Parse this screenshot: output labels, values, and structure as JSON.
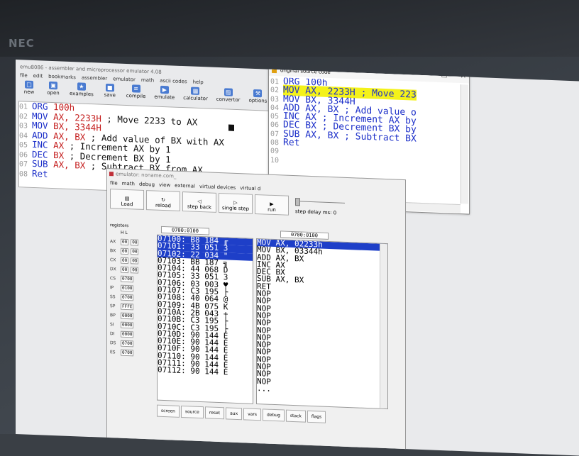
{
  "brand": "NEC",
  "main_window": {
    "title": "emu8086 - assembler and microprocessor emulator 4.08",
    "menu": [
      "file",
      "edit",
      "bookmarks",
      "assembler",
      "emulator",
      "math",
      "ascii codes",
      "help"
    ],
    "toolbar": [
      "new",
      "open",
      "examples",
      "save",
      "compile",
      "emulate",
      "calculator",
      "convertor",
      "options"
    ],
    "code_lines": [
      {
        "n": "01",
        "kw": "ORG",
        "ops": "100h",
        "comment": ""
      },
      {
        "n": "02",
        "kw": "MOV",
        "ops": "AX, 2233H",
        "comment": "; Move 2233 to AX"
      },
      {
        "n": "03",
        "kw": "MOV",
        "ops": "BX, 3344H",
        "comment": ""
      },
      {
        "n": "04",
        "kw": "ADD",
        "ops": "AX, BX",
        "comment": "; Add value of BX with AX"
      },
      {
        "n": "05",
        "kw": "INC",
        "ops": "AX",
        "comment": "; Increment AX by 1"
      },
      {
        "n": "06",
        "kw": "DEC",
        "ops": "BX",
        "comment": "; Decrement BX by 1"
      },
      {
        "n": "07",
        "kw": "SUB",
        "ops": "AX, BX",
        "comment": "; Subtract BX from AX"
      },
      {
        "n": "08",
        "kw": "Ret",
        "ops": "",
        "comment": ""
      }
    ]
  },
  "source_window": {
    "title": "original source code",
    "buttons": [
      "—",
      "☐",
      "✕"
    ],
    "lines": [
      {
        "n": "01",
        "text": "ORG 100h"
      },
      {
        "n": "02",
        "text": "MOV AX, 2233H ; Move 223",
        "highlight": true
      },
      {
        "n": "03",
        "text": "MOV BX, 3344H"
      },
      {
        "n": "04",
        "text": "ADD AX, BX ; Add value o"
      },
      {
        "n": "05",
        "text": "INC AX ; Increment AX by"
      },
      {
        "n": "06",
        "text": "DEC BX ; Decrement BX by"
      },
      {
        "n": "07",
        "text": "SUB AX, BX ; Subtract BX"
      },
      {
        "n": "08",
        "text": "Ret"
      },
      {
        "n": "09",
        "text": ""
      },
      {
        "n": "10",
        "text": ""
      }
    ]
  },
  "emulator": {
    "title": "emulator: noname.com_",
    "menu": [
      "file",
      "math",
      "debug",
      "view",
      "external",
      "virtual devices",
      "virtual d"
    ],
    "tools": [
      "Load",
      "reload",
      "step back",
      "single step",
      "run"
    ],
    "step_delay": "step delay ms: 0",
    "registers_label": "registers",
    "hl_header": [
      "H",
      "L"
    ],
    "registers": [
      {
        "name": "AX",
        "h": "00",
        "l": "00"
      },
      {
        "name": "BX",
        "h": "00",
        "l": "00"
      },
      {
        "name": "CX",
        "h": "00",
        "l": "0D"
      },
      {
        "name": "DX",
        "h": "00",
        "l": "00"
      },
      {
        "name": "CS",
        "v": "0700"
      },
      {
        "name": "IP",
        "v": "0100"
      },
      {
        "name": "SS",
        "v": "0700"
      },
      {
        "name": "SP",
        "v": "FFFE"
      },
      {
        "name": "BP",
        "v": "0000"
      },
      {
        "name": "SI",
        "v": "0000"
      },
      {
        "name": "DI",
        "v": "0000"
      },
      {
        "name": "DS",
        "v": "0700"
      },
      {
        "name": "ES",
        "v": "0700"
      }
    ],
    "mem_addr": "0700:0100",
    "dis_addr": "0700:0100",
    "memory": [
      {
        "a": "07100:",
        "h": "B8",
        "d": "184",
        "c": "╓",
        "sel": true
      },
      {
        "a": "07101:",
        "h": "33",
        "d": "051",
        "c": "3",
        "sel": true
      },
      {
        "a": "07102:",
        "h": "22",
        "d": "034",
        "c": "\"",
        "sel": true
      },
      {
        "a": "07103:",
        "h": "BB",
        "d": "187",
        "c": "╗"
      },
      {
        "a": "07104:",
        "h": "44",
        "d": "068",
        "c": "D"
      },
      {
        "a": "07105:",
        "h": "33",
        "d": "051",
        "c": "3"
      },
      {
        "a": "07106:",
        "h": "03",
        "d": "003",
        "c": "♥"
      },
      {
        "a": "07107:",
        "h": "C3",
        "d": "195",
        "c": "├"
      },
      {
        "a": "07108:",
        "h": "40",
        "d": "064",
        "c": "@"
      },
      {
        "a": "07109:",
        "h": "4B",
        "d": "075",
        "c": "K"
      },
      {
        "a": "0710A:",
        "h": "2B",
        "d": "043",
        "c": "+"
      },
      {
        "a": "0710B:",
        "h": "C3",
        "d": "195",
        "c": "├"
      },
      {
        "a": "0710C:",
        "h": "C3",
        "d": "195",
        "c": "├"
      },
      {
        "a": "0710D:",
        "h": "90",
        "d": "144",
        "c": "É"
      },
      {
        "a": "0710E:",
        "h": "90",
        "d": "144",
        "c": "É"
      },
      {
        "a": "0710F:",
        "h": "90",
        "d": "144",
        "c": "É"
      },
      {
        "a": "07110:",
        "h": "90",
        "d": "144",
        "c": "É"
      },
      {
        "a": "07111:",
        "h": "90",
        "d": "144",
        "c": "É"
      },
      {
        "a": "07112:",
        "h": "90",
        "d": "144",
        "c": "É"
      }
    ],
    "disassembly": [
      {
        "t": "MOV AX, 02233h",
        "sel": true
      },
      {
        "t": "MOV BX, 03344h"
      },
      {
        "t": "ADD AX, BX"
      },
      {
        "t": "INC AX"
      },
      {
        "t": "DEC BX"
      },
      {
        "t": "SUB AX, BX"
      },
      {
        "t": "RET"
      },
      {
        "t": "NOP"
      },
      {
        "t": "NOP"
      },
      {
        "t": "NOP"
      },
      {
        "t": "NOP"
      },
      {
        "t": "NOP"
      },
      {
        "t": "NOP"
      },
      {
        "t": "NOP"
      },
      {
        "t": "NOP"
      },
      {
        "t": "NOP"
      },
      {
        "t": "NOP"
      },
      {
        "t": "NOP"
      },
      {
        "t": "NOP"
      },
      {
        "t": "NOP"
      },
      {
        "t": "..."
      }
    ],
    "bottom_buttons": [
      "screen",
      "source",
      "reset",
      "aux",
      "vars",
      "debug",
      "stack",
      "flags"
    ]
  }
}
